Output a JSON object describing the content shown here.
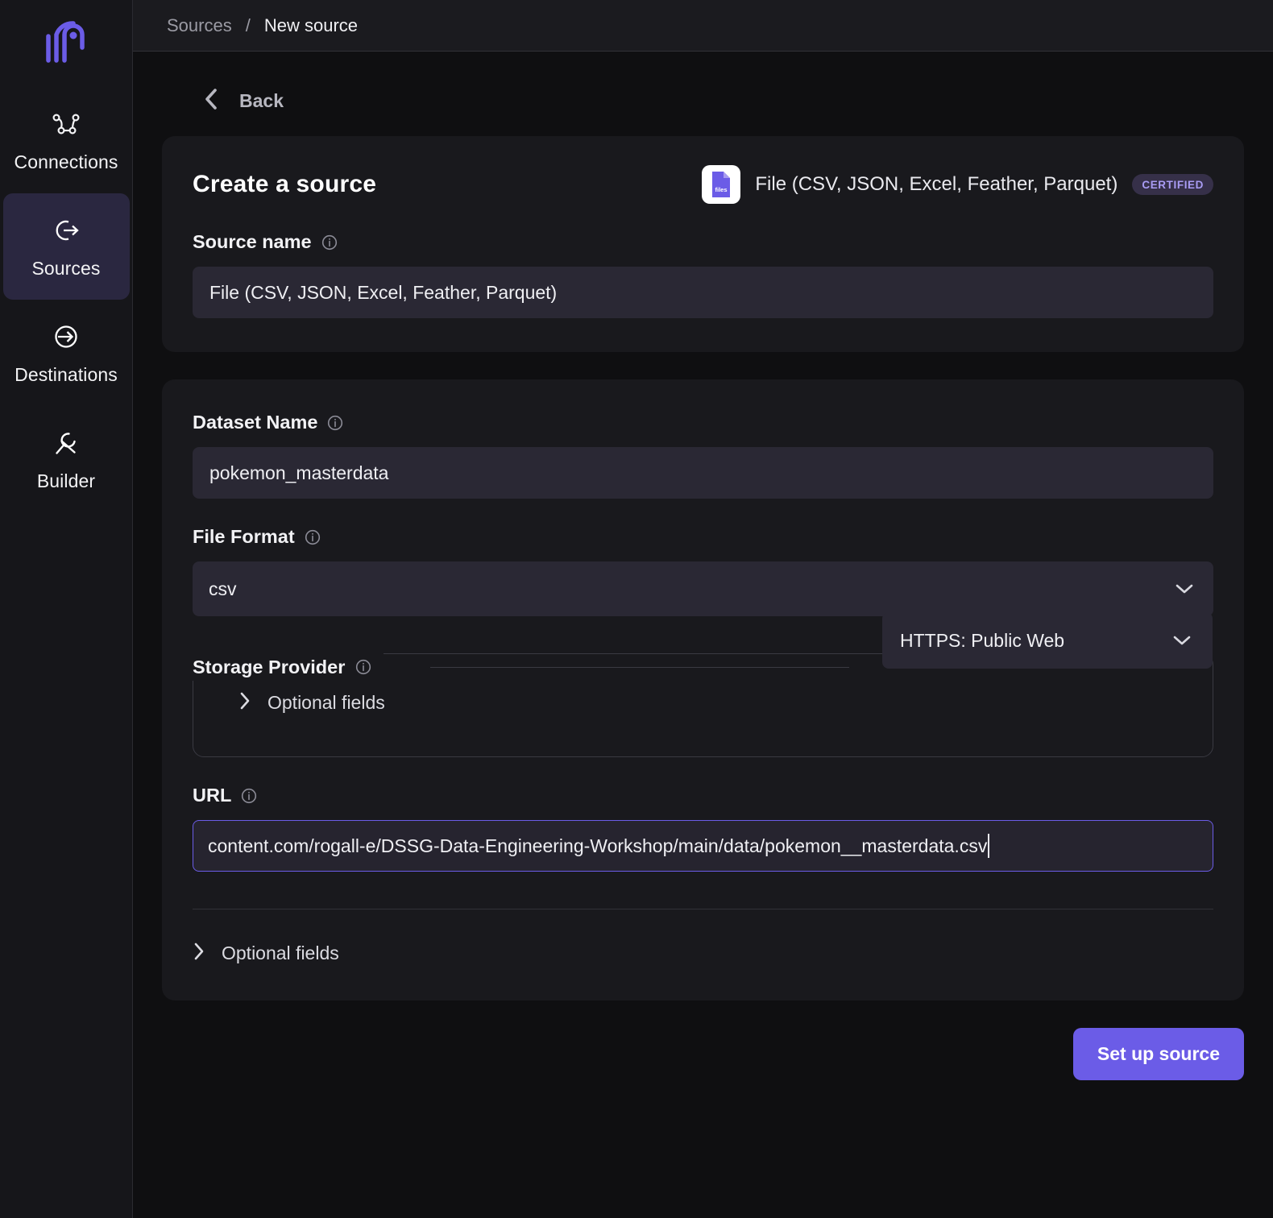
{
  "sidebar": {
    "logo_icon": "airbyte-logo-icon",
    "items": [
      {
        "label": "Connections",
        "icon": "connections-icon",
        "active": false
      },
      {
        "label": "Sources",
        "icon": "sources-arrow-icon",
        "active": true
      },
      {
        "label": "Destinations",
        "icon": "destinations-arrow-icon",
        "active": false
      },
      {
        "label": "Builder",
        "icon": "wrench-icon",
        "active": false
      }
    ]
  },
  "breadcrumb": {
    "parent": "Sources",
    "separator": "/",
    "current": "New source"
  },
  "back": {
    "label": "Back",
    "icon": "chevron-left-icon"
  },
  "source_card": {
    "title": "Create a source",
    "connector": {
      "icon_label": "files",
      "name": "File (CSV, JSON, Excel, Feather, Parquet)",
      "badge": "CERTIFIED"
    },
    "source_name": {
      "label": "Source name",
      "info_icon": "info-circle-icon",
      "value": "File (CSV, JSON, Excel, Feather, Parquet)",
      "placeholder": "Source name"
    }
  },
  "config_card": {
    "dataset_name": {
      "label": "Dataset Name",
      "info_icon": "info-circle-icon",
      "value": "pokemon_masterdata",
      "placeholder": "Dataset Name"
    },
    "file_format": {
      "label": "File Format",
      "info_icon": "info-circle-icon",
      "value": "csv",
      "chevron_icon": "chevron-down-icon"
    },
    "storage_provider": {
      "label": "Storage Provider",
      "info_icon": "info-circle-icon",
      "value": "HTTPS: Public Web",
      "chevron_icon": "chevron-down-icon",
      "optional_fields_label": "Optional fields",
      "optional_fields_icon": "chevron-right-icon"
    },
    "url": {
      "label": "URL",
      "info_icon": "info-circle-icon",
      "value": "content.com/rogall-e/DSSG-Data-Engineering-Workshop/main/data/pokemon__masterdata.csv",
      "placeholder": "URL",
      "focused": true
    },
    "optional_fields": {
      "label": "Optional fields",
      "icon": "chevron-right-icon"
    }
  },
  "footer": {
    "submit_label": "Set up source"
  },
  "colors": {
    "accent": "#6b5ce7",
    "page_bg": "#0f0f11",
    "card_bg": "#19191d",
    "input_bg": "#2a2834",
    "badge_bg": "#363049",
    "badge_text": "#a99cf4"
  }
}
